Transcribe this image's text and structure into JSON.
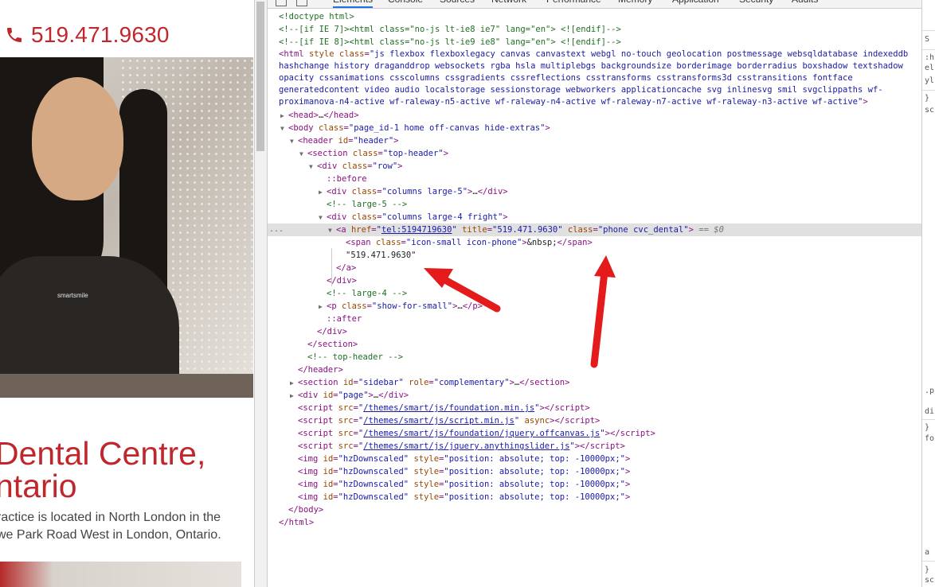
{
  "website": {
    "phone": "519.471.9630",
    "shirt_logo": "smartsmile",
    "title_line1": "Dental Centre,",
    "title_line2": "ntario",
    "para_line1": "ractice is located in North London in the",
    "para_line2": "we Park Road West in London, Ontario."
  },
  "devtools": {
    "tabs": [
      "Elements",
      "Console",
      "Sources",
      "Network",
      "Performance",
      "Memory",
      "Application",
      "Security",
      "Audits"
    ],
    "active_tab": "Elements",
    "selected_row_marker": "..."
  },
  "right_pane": {
    "items": [
      "S",
      ":h",
      "el",
      "yl",
      "}",
      "sc",
      ".p",
      "di",
      "}",
      "fo",
      "a",
      "}",
      "sc",
      "*,"
    ]
  },
  "colors": {
    "brand_red": "#c0272d",
    "tag": "#881280",
    "attr_name": "#994500",
    "attr_value": "#1a1aa6",
    "comment": "#236e25",
    "arrow": "#e41b1b"
  }
}
